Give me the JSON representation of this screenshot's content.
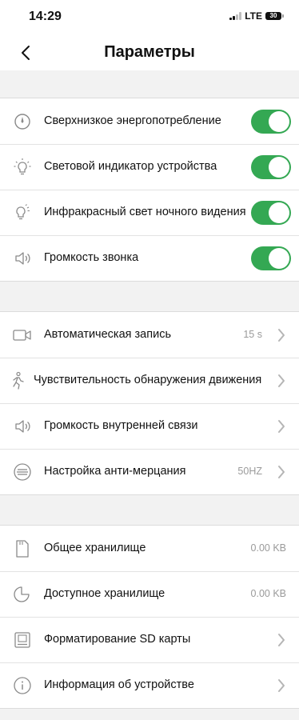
{
  "status": {
    "time": "14:29",
    "network": "LTE",
    "battery": "30"
  },
  "nav": {
    "title": "Параметры",
    "back_icon": "chevron-left-icon"
  },
  "sections": [
    {
      "rows": [
        {
          "icon": "compass-icon",
          "label": "Сверхнизкое энергопотребление",
          "control": "toggle",
          "on": true
        },
        {
          "icon": "lightbulb-icon",
          "label": "Световой индикатор устройства",
          "control": "toggle",
          "on": true
        },
        {
          "icon": "infrared-light-icon",
          "label": "Инфракрасный свет ночного видения",
          "control": "toggle",
          "on": true
        },
        {
          "icon": "speaker-icon",
          "label": "Громкость звонка",
          "control": "toggle",
          "on": true
        }
      ]
    },
    {
      "rows": [
        {
          "icon": "video-camera-icon",
          "label": "Автоматическая запись",
          "value": "15 s",
          "control": "chevron"
        },
        {
          "icon": "running-person-icon",
          "label": "Чувствительность обнаружения движения",
          "control": "chevron"
        },
        {
          "icon": "speaker-icon",
          "label": "Громкость внутренней связи",
          "control": "chevron"
        },
        {
          "icon": "anti-flicker-icon",
          "label": "Настройка анти-мерцания",
          "value": "50HZ",
          "control": "chevron"
        }
      ]
    },
    {
      "rows": [
        {
          "icon": "sd-card-icon",
          "label": "Общее хранилище",
          "value": "0.00 KB",
          "control": "none"
        },
        {
          "icon": "pie-chart-icon",
          "label": "Доступное хранилище",
          "value": "0.00 KB",
          "control": "none"
        },
        {
          "icon": "format-drive-icon",
          "label": "Форматирование SD карты",
          "control": "chevron"
        },
        {
          "icon": "info-icon",
          "label": "Информация об устройстве",
          "control": "chevron"
        }
      ]
    }
  ],
  "colors": {
    "toggle_on": "#34a853",
    "background": "#f2f2f2",
    "secondary_text": "#9a9a9a"
  }
}
